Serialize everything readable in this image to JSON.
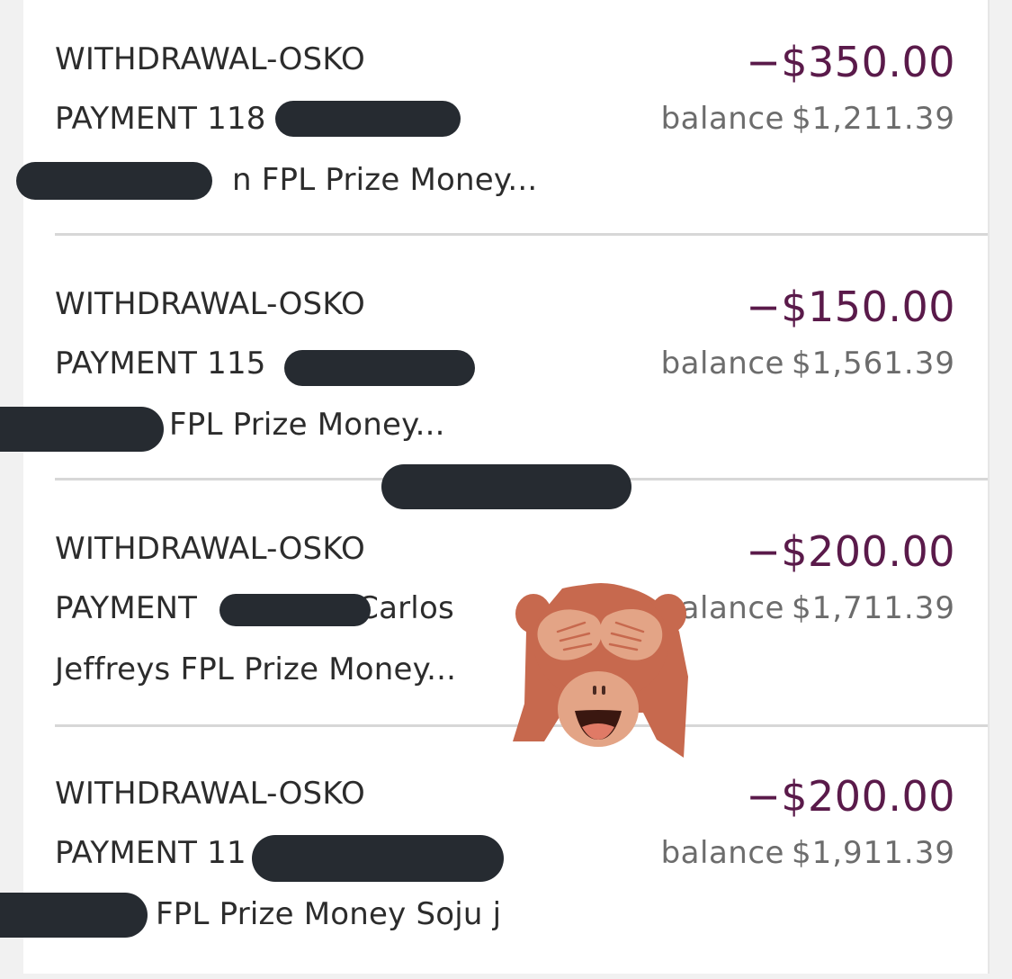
{
  "transactions": [
    {
      "line1": "WITHDRAWAL-OSKO",
      "line2": "PAYMENT 118",
      "line3": "n FPL Prize Money...",
      "amount": "−$350.00",
      "balance_label": "balance",
      "balance": "$1,211.39"
    },
    {
      "line1": "WITHDRAWAL-OSKO",
      "line2": "PAYMENT 115",
      "line3": "FPL Prize Money...",
      "amount": "−$150.00",
      "balance_label": "balance",
      "balance": "$1,561.39"
    },
    {
      "line1": "WITHDRAWAL-OSKO",
      "line2": "PAYMENT",
      "line2_suffix": "Carlos",
      "line3": "Jeffreys FPL Prize Money...",
      "amount": "−$200.00",
      "balance_label": "balance",
      "balance": "$1,711.39"
    },
    {
      "line1": "WITHDRAWAL-OSKO",
      "line2": "PAYMENT 11",
      "line3": "FPL Prize Money Soju j",
      "amount": "−$200.00",
      "balance_label": "balance",
      "balance": "$1,911.39"
    }
  ],
  "overlays": {
    "redaction_color": "#262b31",
    "emoji": "see-no-evil-monkey-icon"
  },
  "colors": {
    "amount": "#5a1a4a",
    "balance": "#6c6c6c",
    "text": "#2c2c2c"
  }
}
